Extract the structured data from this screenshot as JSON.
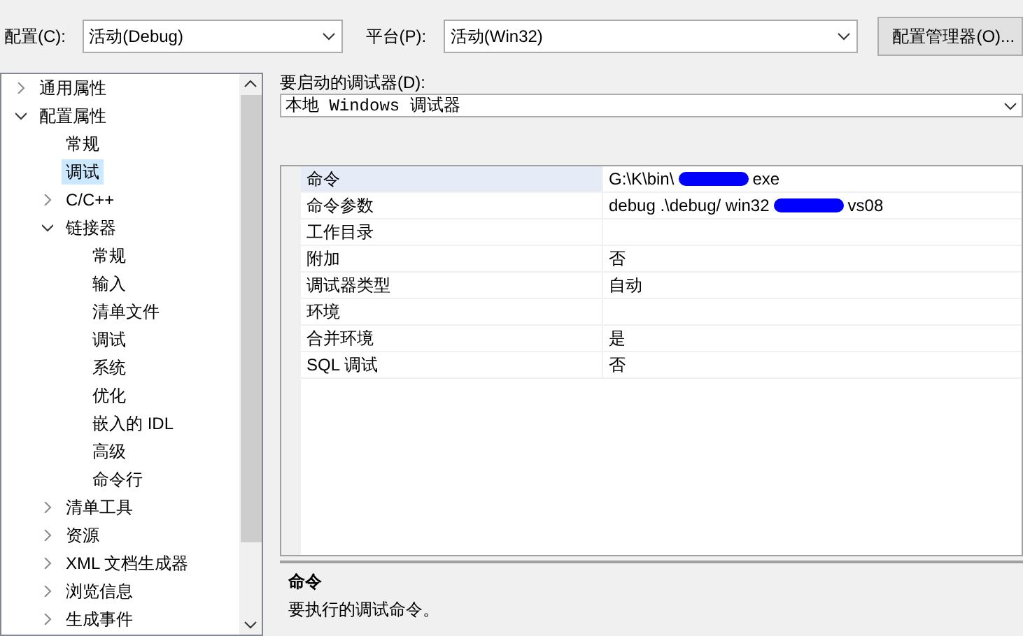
{
  "toolbar": {
    "config_label": "配置(C):",
    "config_value": "活动(Debug)",
    "platform_label": "平台(P):",
    "platform_value": "活动(Win32)",
    "manager_button": "配置管理器(O)..."
  },
  "tree": [
    {
      "label": "通用属性",
      "expanded": false,
      "selected": false
    },
    {
      "label": "配置属性",
      "expanded": true,
      "selected": false,
      "children": [
        {
          "label": "常规",
          "selected": false
        },
        {
          "label": "调试",
          "selected": true
        },
        {
          "label": "C/C++",
          "expanded": false,
          "selected": false
        },
        {
          "label": "链接器",
          "expanded": true,
          "selected": false,
          "children": [
            {
              "label": "常规",
              "selected": false
            },
            {
              "label": "输入",
              "selected": false
            },
            {
              "label": "清单文件",
              "selected": false
            },
            {
              "label": "调试",
              "selected": false
            },
            {
              "label": "系统",
              "selected": false
            },
            {
              "label": "优化",
              "selected": false
            },
            {
              "label": "嵌入的 IDL",
              "selected": false
            },
            {
              "label": "高级",
              "selected": false
            },
            {
              "label": "命令行",
              "selected": false
            }
          ]
        },
        {
          "label": "清单工具",
          "expanded": false,
          "selected": false
        },
        {
          "label": "资源",
          "expanded": false,
          "selected": false
        },
        {
          "label": "XML 文档生成器",
          "expanded": false,
          "selected": false
        },
        {
          "label": "浏览信息",
          "expanded": false,
          "selected": false
        },
        {
          "label": "生成事件",
          "expanded": false,
          "selected": false
        }
      ]
    }
  ],
  "debugger": {
    "label": "要启动的调试器(D):",
    "value": "本地 Windows 调试器"
  },
  "properties": [
    {
      "name": "命令",
      "selected": true,
      "value": [
        {
          "kind": "text",
          "text": "G:\\K\\bin\\"
        },
        {
          "kind": "redaction"
        },
        {
          "kind": "text",
          "text": "exe"
        }
      ]
    },
    {
      "name": "命令参数",
      "selected": false,
      "value": [
        {
          "kind": "text",
          "text": "debug .\\debug/ win32"
        },
        {
          "kind": "redaction"
        },
        {
          "kind": "text",
          "text": "vs08"
        }
      ]
    },
    {
      "name": "工作目录",
      "selected": false
    },
    {
      "name": "附加",
      "selected": false,
      "value": [
        {
          "kind": "text",
          "text": "否"
        }
      ]
    },
    {
      "name": "调试器类型",
      "selected": false,
      "value": [
        {
          "kind": "text",
          "text": "自动"
        }
      ]
    },
    {
      "name": "环境",
      "selected": false
    },
    {
      "name": "合并环境",
      "selected": false,
      "value": [
        {
          "kind": "text",
          "text": "是"
        }
      ]
    },
    {
      "name": "SQL 调试",
      "selected": false,
      "value": [
        {
          "kind": "text",
          "text": "否"
        }
      ]
    }
  ],
  "description": {
    "title": "命令",
    "text": "要执行的调试命令。"
  }
}
